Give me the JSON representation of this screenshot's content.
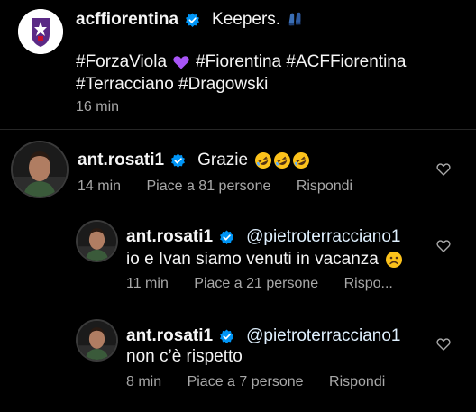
{
  "caption": {
    "username": "acffiorentina",
    "text": "Keepers.",
    "hashtags_line1": "#ForzaViola",
    "hashtags_line1_rest": "#Fiorentina #ACFFiorentina",
    "hashtags_line2": "#Terracciano #Dragowski",
    "time": "16 min"
  },
  "comments": [
    {
      "username": "ant.rosati1",
      "text": "Grazie",
      "time": "14 min",
      "likes": "Piace a 81 persone",
      "reply": "Rispondi",
      "emoji": [
        "rolling-laughing-emoji",
        "rolling-laughing-emoji",
        "rolling-laughing-emoji"
      ]
    },
    {
      "username": "ant.rosati1",
      "mention": "@pietroterracciano1",
      "text_line2": "io e Ivan siamo venuti in vacanza",
      "time": "11 min",
      "likes": "Piace a 21 persone",
      "reply": "Rispo...",
      "emoji": [
        "frowning-face-emoji"
      ]
    },
    {
      "username": "ant.rosati1",
      "mention": "@pietroterracciano1",
      "text_line2": "non c’è rispetto",
      "time": "8 min",
      "likes": "Piace a 7 persone",
      "reply": "Rispondi"
    }
  ],
  "colors": {
    "background": "#000000",
    "text": "#f5f5f5",
    "secondary": "#a8a8a8",
    "verified": "#0095f6",
    "heart_purple": "#a855f7",
    "fiorentina_purple": "#5b2a86"
  }
}
